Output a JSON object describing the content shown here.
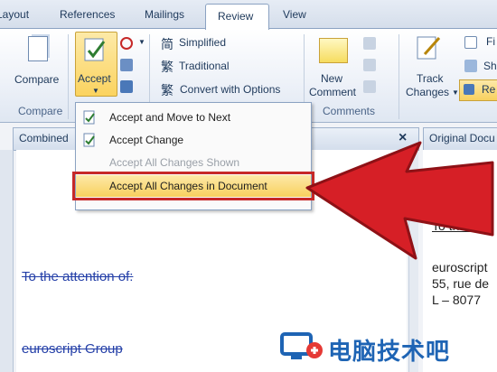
{
  "tabs": [
    "Layout",
    "References",
    "Mailings",
    "Review",
    "View"
  ],
  "ribbon": {
    "compare_label": "Compare",
    "compare_group": "Compare",
    "accept_label": "Accept",
    "simplified": "Simplified",
    "traditional": "Traditional",
    "convert_with_options": "Convert with Options",
    "new_comment_line1": "New",
    "new_comment_line2": "Comment",
    "comments_group": "Comments",
    "track_changes_line1": "Track",
    "track_changes_line2": "Changes",
    "right_cut_1": "Fi",
    "right_cut_2": "Sh",
    "right_cut_3": "Re"
  },
  "menu": {
    "items": [
      {
        "label": "Accept and Move to Next",
        "enabled": true
      },
      {
        "label": "Accept Change",
        "enabled": true
      },
      {
        "label": "Accept All Changes Shown",
        "enabled": false
      },
      {
        "label": "Accept All Changes in Document",
        "enabled": true,
        "highlighted": true
      }
    ]
  },
  "left_pane": {
    "title": "Combined",
    "close": "×",
    "lines": [
      "To the attention of:",
      "euroscript Group"
    ]
  },
  "right_pane": {
    "title": "Original Docu",
    "lines": [
      "To the att",
      "euroscript",
      "55, rue de",
      "L – 8077"
    ]
  },
  "watermark": {
    "text": "电脑技术吧"
  },
  "colors": {
    "accent_red": "#d61f26",
    "highlight": "#f8d05e",
    "strike_blue": "#2540a8"
  }
}
